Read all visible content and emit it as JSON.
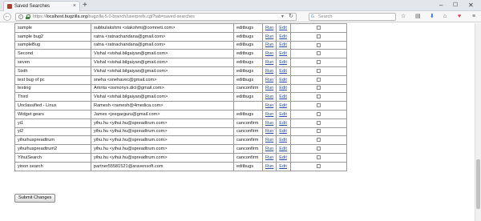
{
  "browser": {
    "tab_title": "Saved Searches",
    "new_tab_label": "+",
    "url_prefix": "https://",
    "url_host": "localhost.bugzilla.org",
    "url_path": "/bugzilla-5.0-branch/userprefs.cgi?tab=saved-searches",
    "search_placeholder": "Search",
    "colors": {
      "titlebar": "#e3e7ec",
      "link": "#2a4fa5"
    }
  },
  "saved_searches": {
    "rows": [
      {
        "name": "sample",
        "owner": "subbulakshmi <slakshmi@comneti.com>",
        "group": "editbugs",
        "run": "Run",
        "edit": "Edit"
      },
      {
        "name": "sample bug2",
        "owner": "ratna <ratnachandana@gmail.com>",
        "group": "editbugs",
        "run": "Run",
        "edit": "Edit"
      },
      {
        "name": "sampleBug",
        "owner": "ratna <ratnachandana@gmail.com>",
        "group": "editbugs",
        "run": "Run",
        "edit": "Edit"
      },
      {
        "name": "Second",
        "owner": "Vishal <vishal.bilgaiyan@gmail.com>",
        "group": "editbugs",
        "run": "Run",
        "edit": "Edit"
      },
      {
        "name": "seven",
        "owner": "Vishal <vishal.bilgaiyan@gmail.com>",
        "group": "editbugs",
        "run": "Run",
        "edit": "Edit"
      },
      {
        "name": "Sixth",
        "owner": "Vishal <vishal.bilgaiyan@gmail.com>",
        "group": "editbugs",
        "run": "Run",
        "edit": "Edit"
      },
      {
        "name": "test bug of pc",
        "owner": "sneha <snehavec@gmail.com>",
        "group": "editbugs",
        "run": "Run",
        "edit": "Edit"
      },
      {
        "name": "testing",
        "owner": "Amrita <osmonys.dici@gmail.com>",
        "group": "canconfirm",
        "run": "Run",
        "edit": "Edit"
      },
      {
        "name": "Third",
        "owner": "Vishal <vishal.bilgaiyan@gmail.com>",
        "group": "editbugs",
        "run": "Run",
        "edit": "Edit"
      },
      {
        "name": "Unclassified - Linux",
        "owner": "Ramesh <ramesh@4medica.com>",
        "group": "",
        "run": "Run",
        "edit": "Edit"
      },
      {
        "name": "Widget gears",
        "owner": "James <jeegarguru@gmail.com>",
        "group": "editbugs",
        "run": "Run",
        "edit": "Edit"
      },
      {
        "name": "yi1",
        "owner": "yihu.hu <yihui.hu@spreadtrum.com>",
        "group": "canconfirm",
        "run": "Run",
        "edit": "Edit"
      },
      {
        "name": "yi2",
        "owner": "yihu.hu <yihui.hu@spreadtrum.com>",
        "group": "canconfirm",
        "run": "Run",
        "edit": "Edit"
      },
      {
        "name": "yihuihuspreadtrum",
        "owner": "yihu.hu <yihui.hu@spreadtrum.com>",
        "group": "canconfirm",
        "run": "Run",
        "edit": "Edit"
      },
      {
        "name": "yihuihuspreadtrum2",
        "owner": "yihu.hu <yihui.hu@spreadtrum.com>",
        "group": "canconfirm",
        "run": "Run",
        "edit": "Edit"
      },
      {
        "name": "YihuiSearch",
        "owner": "yihu.hu <yihui.hu@spreadtrum.com>",
        "group": "canconfirm",
        "run": "Run",
        "edit": "Edit"
      },
      {
        "name": "yinon search",
        "owner": "partner55581521@aravensoft.com",
        "group": "editbugs",
        "run": "Run",
        "edit": "Edit"
      }
    ],
    "submit_label": "Submit Changes"
  }
}
